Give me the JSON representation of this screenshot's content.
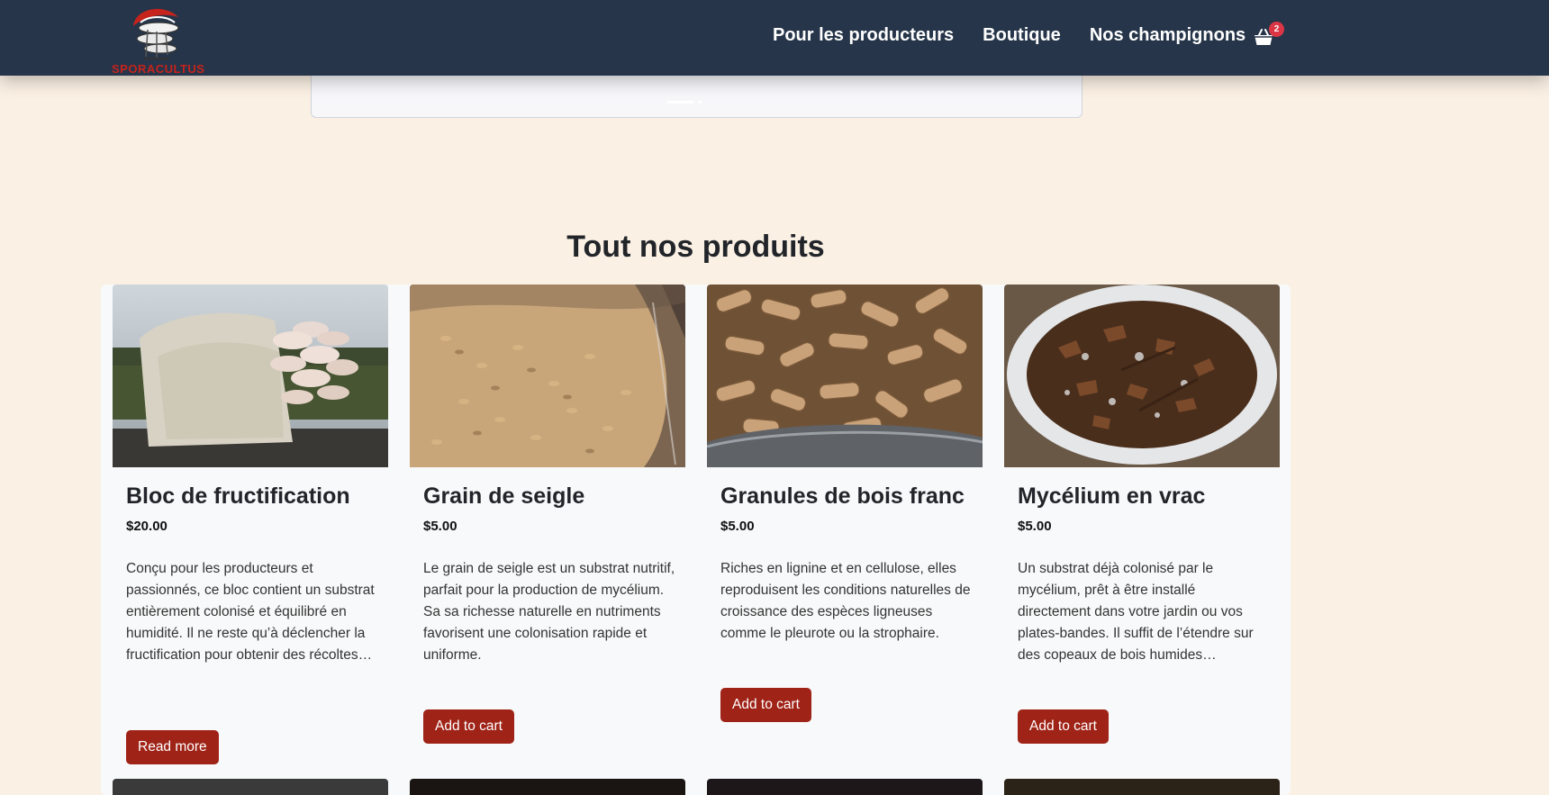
{
  "brand": {
    "name": "SPORACULTUS"
  },
  "nav": {
    "links": [
      "Pour les producteurs",
      "Boutique",
      "Nos champignons"
    ],
    "cart_count": "2"
  },
  "section": {
    "title": "Tout nos produits"
  },
  "products": [
    {
      "title": "Bloc de fructification",
      "price": "$20.00",
      "description": "Conçu pour les producteurs et passionnés, ce bloc contient un substrat entièrement colonisé et équilibré en humidité. Il ne reste qu’à déclencher la fructification pour obtenir des récoltes…",
      "button": "Read more"
    },
    {
      "title": "Grain de seigle",
      "price": "$5.00",
      "description": "Le grain de seigle est un substrat nutritif, parfait pour la production de mycélium. Sa sa richesse naturelle en nutriments favorisent une colonisation rapide et uniforme.",
      "button": "Add to cart"
    },
    {
      "title": "Granules de bois franc",
      "price": "$5.00",
      "description": "Riches en lignine et en cellulose, elles reproduisent les conditions naturelles de croissance des espèces ligneuses comme le pleurote ou la strophaire.",
      "button": "Add to cart"
    },
    {
      "title": "Mycélium en vrac",
      "price": "$5.00",
      "description": "Un substrat déjà colonisé par le mycélium, prêt à être installé directement dans votre jardin ou vos plates-bandes. Il suffit de l’étendre sur des copeaux de bois humides…",
      "button": "Add to cart"
    }
  ],
  "colors": {
    "navbar": "#263549",
    "page_bg": "#fbf0e4",
    "button": "#9f2317",
    "badge": "#dc3545",
    "brand": "#c6231d"
  },
  "icons": [
    "mushroom-logo-icon",
    "shopping-basket-icon"
  ]
}
